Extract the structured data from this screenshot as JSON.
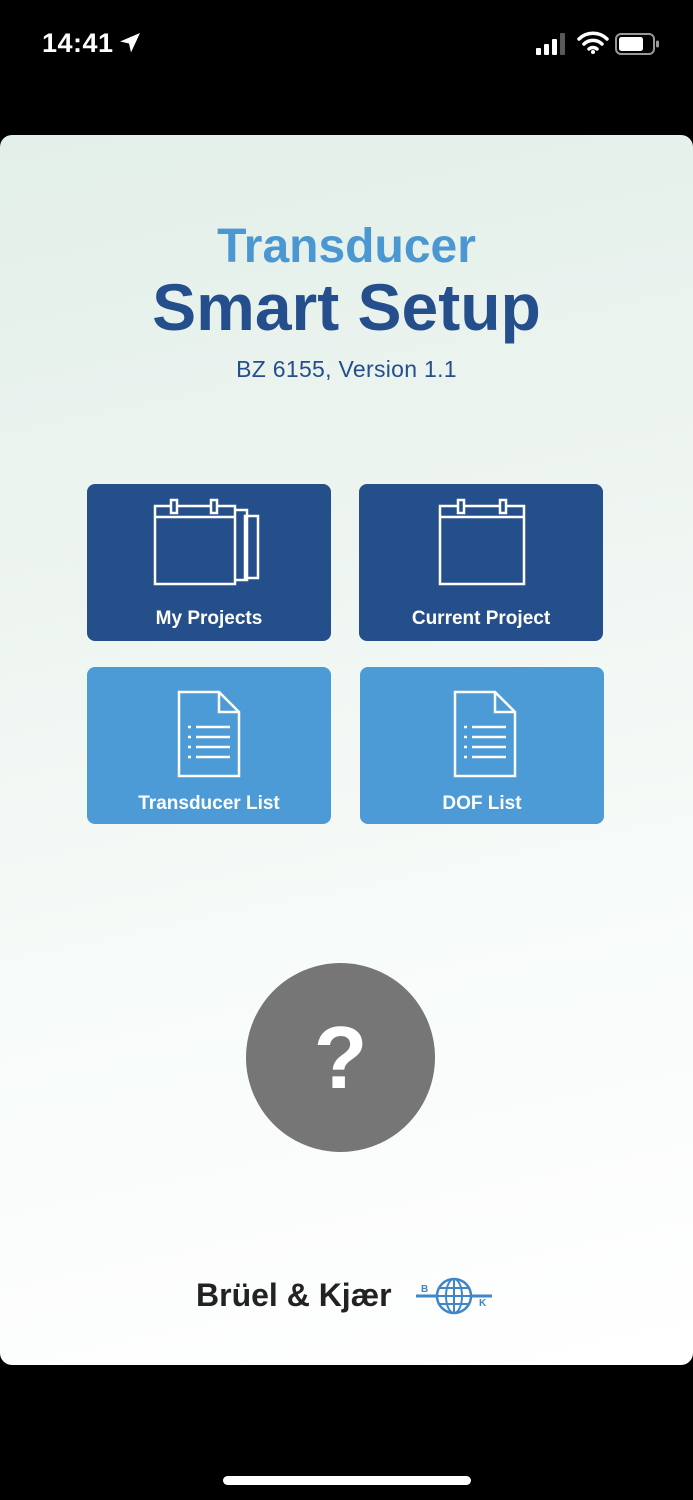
{
  "status_bar": {
    "time": "14:41"
  },
  "app": {
    "title_line1": "Transducer",
    "title_line2": "Smart Setup",
    "version": "BZ 6155, Version 1.1"
  },
  "tiles": [
    {
      "label": "My Projects",
      "icon": "calendar-stack-icon"
    },
    {
      "label": "Current Project",
      "icon": "calendar-icon"
    },
    {
      "label": "Transducer List",
      "icon": "document-list-icon"
    },
    {
      "label": "DOF List",
      "icon": "document-list-icon"
    }
  ],
  "help": {
    "symbol": "?"
  },
  "brand": {
    "name": "Brüel & Kjær",
    "logo_letters": [
      "B",
      "K"
    ]
  },
  "colors": {
    "tile_dark": "#254f8a",
    "tile_light": "#4c9bd6",
    "title_light": "#4b97d2",
    "title_dark": "#244f8c",
    "help_button": "#767676"
  }
}
